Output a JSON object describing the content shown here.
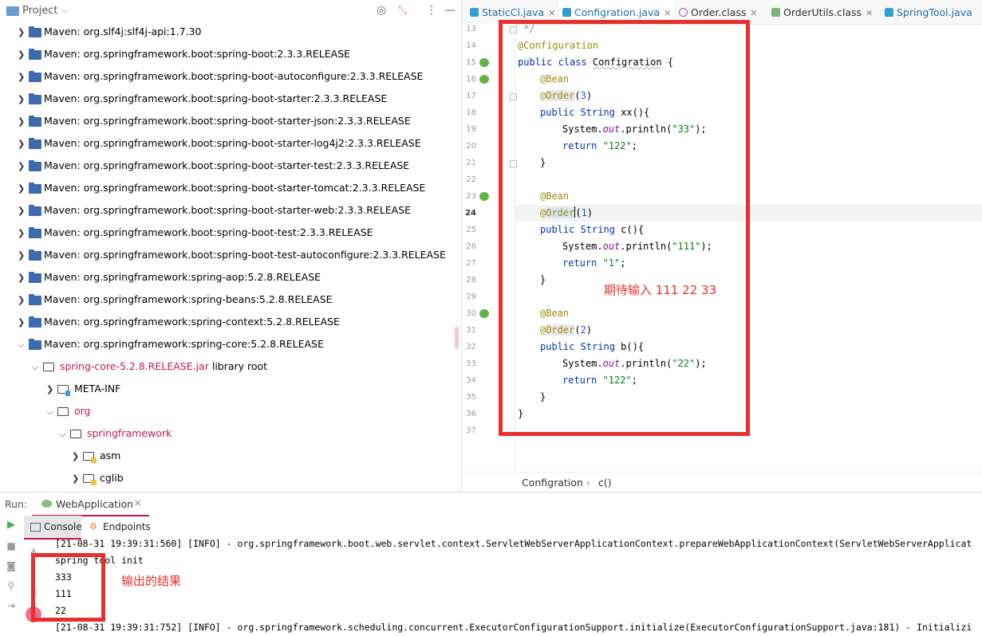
{
  "project": {
    "title": "Project",
    "items": [
      {
        "label": "Maven: org.slf4j:slf4j-api:1.7.30"
      },
      {
        "label": "Maven: org.springframework.boot:spring-boot:2.3.3.RELEASE"
      },
      {
        "label": "Maven: org.springframework.boot:spring-boot-autoconfigure:2.3.3.RELEASE"
      },
      {
        "label": "Maven: org.springframework.boot:spring-boot-starter:2.3.3.RELEASE"
      },
      {
        "label": "Maven: org.springframework.boot:spring-boot-starter-json:2.3.3.RELEASE"
      },
      {
        "label": "Maven: org.springframework.boot:spring-boot-starter-log4j2:2.3.3.RELEASE"
      },
      {
        "label": "Maven: org.springframework.boot:spring-boot-starter-test:2.3.3.RELEASE"
      },
      {
        "label": "Maven: org.springframework.boot:spring-boot-starter-tomcat:2.3.3.RELEASE"
      },
      {
        "label": "Maven: org.springframework.boot:spring-boot-starter-web:2.3.3.RELEASE"
      },
      {
        "label": "Maven: org.springframework.boot:spring-boot-test:2.3.3.RELEASE"
      },
      {
        "label": "Maven: org.springframework.boot:spring-boot-test-autoconfigure:2.3.3.RELEASE"
      },
      {
        "label": "Maven: org.springframework:spring-aop:5.2.8.RELEASE"
      },
      {
        "label": "Maven: org.springframework:spring-beans:5.2.8.RELEASE"
      },
      {
        "label": "Maven: org.springframework:spring-context:5.2.8.RELEASE"
      },
      {
        "label": "Maven: org.springframework:spring-core:5.2.8.RELEASE"
      }
    ],
    "jar": {
      "label": "spring-core-5.2.8.RELEASE.jar",
      "suffix": "library root"
    },
    "meta_inf": "META-INF",
    "org": "org",
    "springframework": "springframework",
    "asm": "asm",
    "cglib": "cglib"
  },
  "editor": {
    "tabs": [
      "StaticCl.java",
      "Configration.java",
      "Order.class",
      "OrderUtils.class",
      "SpringTool.java"
    ],
    "line_numbers": [
      "13",
      "14",
      "15",
      "16",
      "17",
      "18",
      "19",
      "20",
      "21",
      "22",
      "23",
      "24",
      "25",
      "26",
      "27",
      "28",
      "29",
      "30",
      "31",
      "32",
      "33",
      "34",
      "35",
      "36",
      "37"
    ],
    "code": {
      "l13": " */",
      "l14": "@Configuration",
      "l15_kw": "public class ",
      "l15_cls": "Configration",
      "l15_end": " {",
      "bean": "@Bean",
      "order_at": "@",
      "order_name": "Order",
      "order_val_3": "3",
      "order_val_1": "1",
      "order_val_2": "2",
      "public_string": "public String ",
      "m_xx": "xx(){",
      "m_c": "c(){",
      "m_b": "b(){",
      "sys": "System.",
      "out": "out",
      "println": ".println(",
      "s33": "\"33\"",
      "s111": "\"111\"",
      "s22": "\"22\"",
      "close_paren": ");",
      "ret_kw": "return ",
      "r122": "\"122\"",
      "r1": "\"1\"",
      "semi": ";",
      "brace": "}"
    },
    "breadcrumb": {
      "cls": "Configration",
      "sep": "›",
      "method": "c()"
    }
  },
  "annotations": {
    "expect": "期待输入 111 22 33",
    "result": "输出的结果"
  },
  "run": {
    "label": "Run:",
    "tab": "WebApplication",
    "console": "Console",
    "endpoints": "Endpoints",
    "lines": [
      "[21-08-31 19:39:31:560] [INFO] - org.springframework.boot.web.servlet.context.ServletWebServerApplicationContext.prepareWebApplicationContext(ServletWebServerApplicat",
      "spring tool init",
      "333",
      "111",
      "22",
      "[21-08-31 19:39:31:752] [INFO] - org.springframework.scheduling.concurrent.ExecutorConfigurationSupport.initialize(ExecutorConfigurationSupport.java:181) - Initializi"
    ]
  }
}
